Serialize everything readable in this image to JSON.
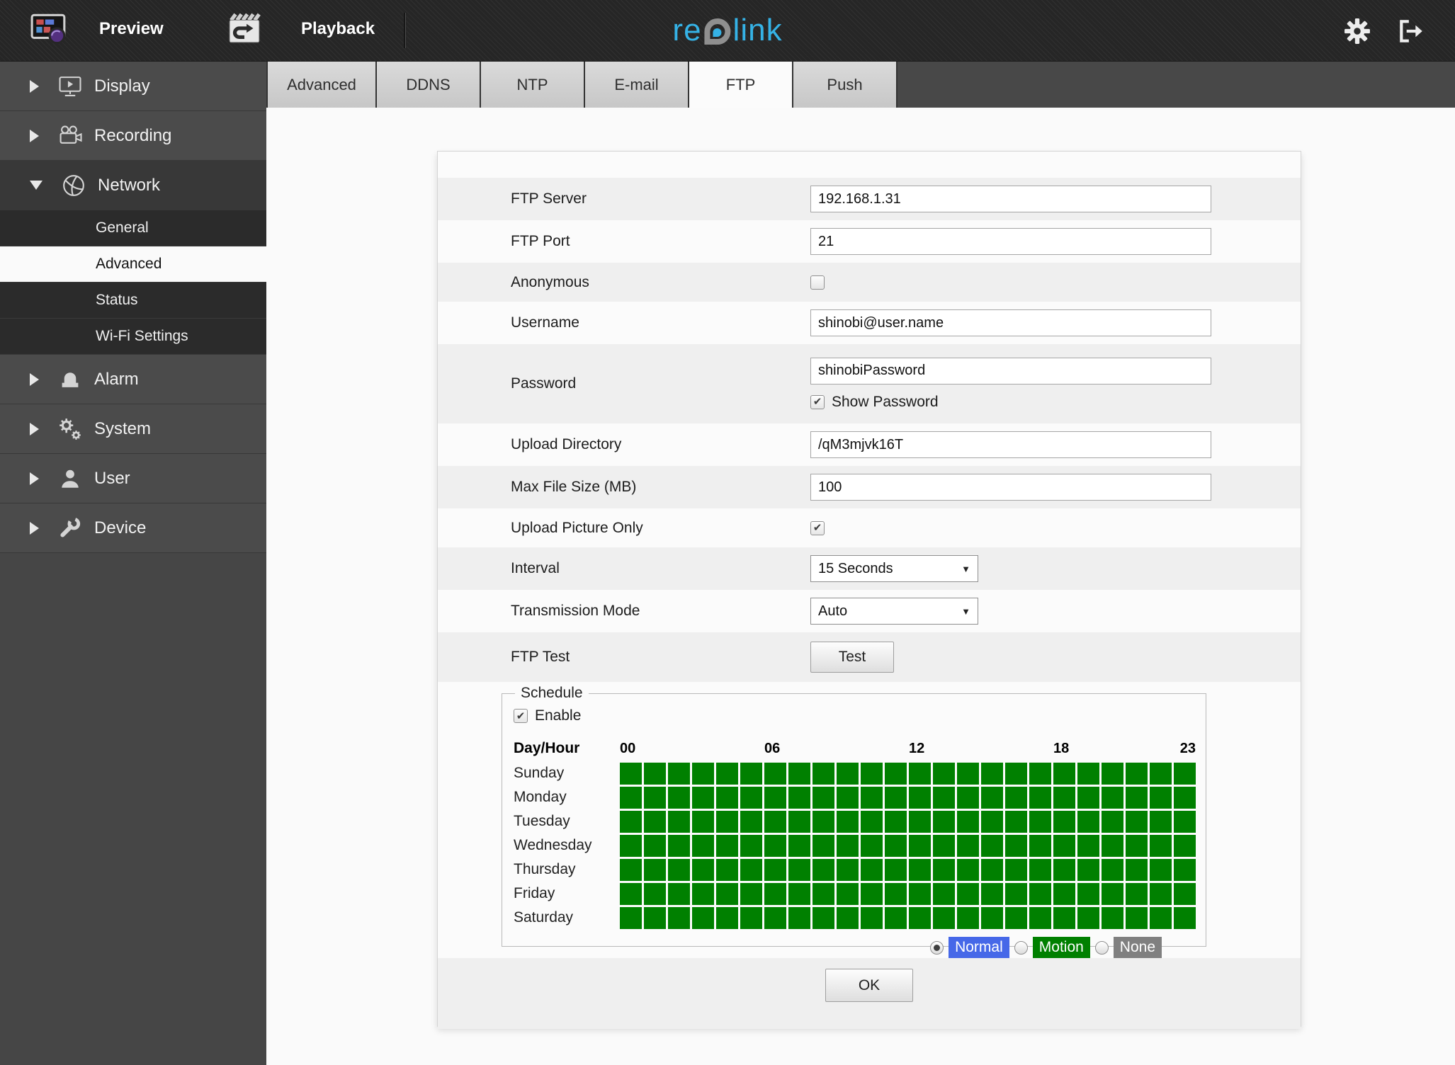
{
  "topbar": {
    "preview_label": "Preview",
    "playback_label": "Playback",
    "logo": {
      "part1": "re",
      "part2": "link"
    },
    "icons": [
      "preview-icon",
      "playback-icon",
      "settings-gear-icon",
      "logout-icon"
    ]
  },
  "sidebar": {
    "items": [
      {
        "label": "Display",
        "icon": "monitor-play-icon",
        "expanded": false
      },
      {
        "label": "Recording",
        "icon": "video-camera-icon",
        "expanded": false
      },
      {
        "label": "Network",
        "icon": "globe-icon",
        "expanded": true,
        "children": [
          {
            "label": "General",
            "selected": false
          },
          {
            "label": "Advanced",
            "selected": true
          },
          {
            "label": "Status",
            "selected": false
          },
          {
            "label": "Wi-Fi Settings",
            "selected": false
          }
        ]
      },
      {
        "label": "Alarm",
        "icon": "siren-icon",
        "expanded": false
      },
      {
        "label": "System",
        "icon": "gears-icon",
        "expanded": false
      },
      {
        "label": "User",
        "icon": "user-icon",
        "expanded": false
      },
      {
        "label": "Device",
        "icon": "wrench-icon",
        "expanded": false
      }
    ]
  },
  "tabs": {
    "items": [
      {
        "label": "Advanced",
        "active": false
      },
      {
        "label": "DDNS",
        "active": false
      },
      {
        "label": "NTP",
        "active": false
      },
      {
        "label": "E-mail",
        "active": false
      },
      {
        "label": "FTP",
        "active": true
      },
      {
        "label": "Push",
        "active": false
      }
    ]
  },
  "form": {
    "rows": [
      {
        "name": "ftp-server",
        "label": "FTP Server",
        "type": "text",
        "value": "192.168.1.31"
      },
      {
        "name": "ftp-port",
        "label": "FTP Port",
        "type": "text",
        "value": "21"
      },
      {
        "name": "anonymous",
        "label": "Anonymous",
        "type": "checkbox",
        "checked": false
      },
      {
        "name": "username",
        "label": "Username",
        "type": "text",
        "value": "shinobi@user.name"
      },
      {
        "name": "password",
        "label": "Password",
        "type": "text",
        "value": "shinobiPassword",
        "extra_checkbox": {
          "label": "Show Password",
          "checked": true
        }
      },
      {
        "name": "upload-directory",
        "label": "Upload Directory",
        "type": "text",
        "value": "/qM3mjvk16T"
      },
      {
        "name": "max-file-size",
        "label": "Max File Size (MB)",
        "type": "text",
        "value": "100"
      },
      {
        "name": "upload-picture-only",
        "label": "Upload Picture Only",
        "type": "checkbox",
        "checked": true
      },
      {
        "name": "interval",
        "label": "Interval",
        "type": "select",
        "value": "15 Seconds"
      },
      {
        "name": "transmission-mode",
        "label": "Transmission Mode",
        "type": "select",
        "value": "Auto"
      },
      {
        "name": "ftp-test",
        "label": "FTP Test",
        "type": "button",
        "value": "Test"
      }
    ]
  },
  "schedule": {
    "title": "Schedule",
    "enable_label": "Enable",
    "enabled": true,
    "corner_label": "Day/Hour",
    "hour_labels": [
      {
        "text": "00",
        "col": 0
      },
      {
        "text": "06",
        "col": 6
      },
      {
        "text": "12",
        "col": 12
      },
      {
        "text": "18",
        "col": 18
      },
      {
        "text": "23",
        "col": 23
      }
    ],
    "days": [
      "Sunday",
      "Monday",
      "Tuesday",
      "Wednesday",
      "Thursday",
      "Friday",
      "Saturday"
    ],
    "hours_per_day": 24,
    "all_cells_state": "motion",
    "state_colors": {
      "normal": "#4668e8",
      "motion": "#008000",
      "none": "#808080"
    },
    "legend": [
      {
        "label": "Normal",
        "state": "normal",
        "selected": true
      },
      {
        "label": "Motion",
        "state": "motion",
        "selected": false
      },
      {
        "label": "None",
        "state": "none",
        "selected": false
      }
    ]
  },
  "ok_button_label": "OK",
  "colors": {
    "brand_cyan": "#35b2e6",
    "schedule_green": "#008000",
    "normal_blue": "#4668e8",
    "none_gray": "#808080",
    "sidebar_dark": "#464646",
    "panel_stripe": "#efefef"
  }
}
